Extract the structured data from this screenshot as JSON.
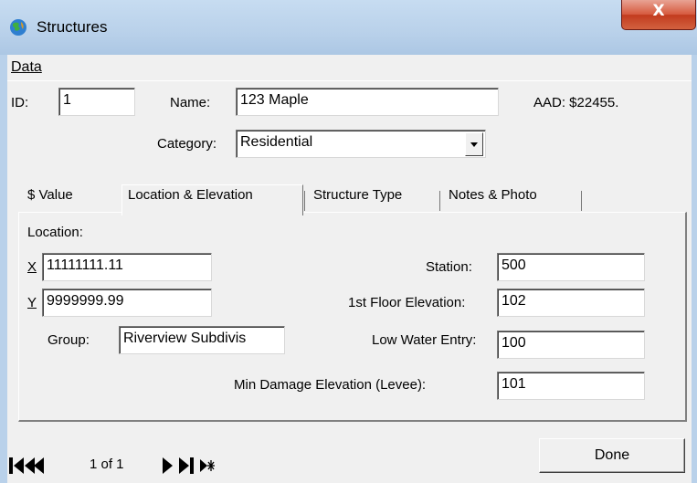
{
  "window": {
    "title": "Structures",
    "close_label": "X"
  },
  "menu": {
    "data_label": "Data"
  },
  "header": {
    "id_label": "ID:",
    "id_value": "1",
    "name_label": "Name:",
    "name_value": "123 Maple",
    "aad": "AAD: $22455.",
    "category_label": "Category:",
    "category_value": "Residential"
  },
  "tabs": [
    {
      "label": "$ Value"
    },
    {
      "label": "Location & Elevation",
      "active": true
    },
    {
      "label": "Structure Type"
    },
    {
      "label": "Notes & Photo"
    }
  ],
  "location": {
    "section_label": "Location:",
    "x_label": "X",
    "x_value": "11111111.11",
    "y_label": "Y",
    "y_value": "9999999.99",
    "group_label": "Group:",
    "group_value": "Riverview Subdivis",
    "station_label": "Station:",
    "station_value": "500",
    "first_floor_label": "1st Floor Elevation:",
    "first_floor_value": "102",
    "low_water_label": "Low Water Entry:",
    "low_water_value": "100",
    "min_damage_label": "Min Damage Elevation (Levee):",
    "min_damage_value": "101"
  },
  "navigator": {
    "record_text": "1 of 1"
  },
  "done_label": "Done",
  "colors": {
    "titlebar": "#b9d1ea",
    "close": "#c74b31",
    "client": "#f0f0f0"
  }
}
